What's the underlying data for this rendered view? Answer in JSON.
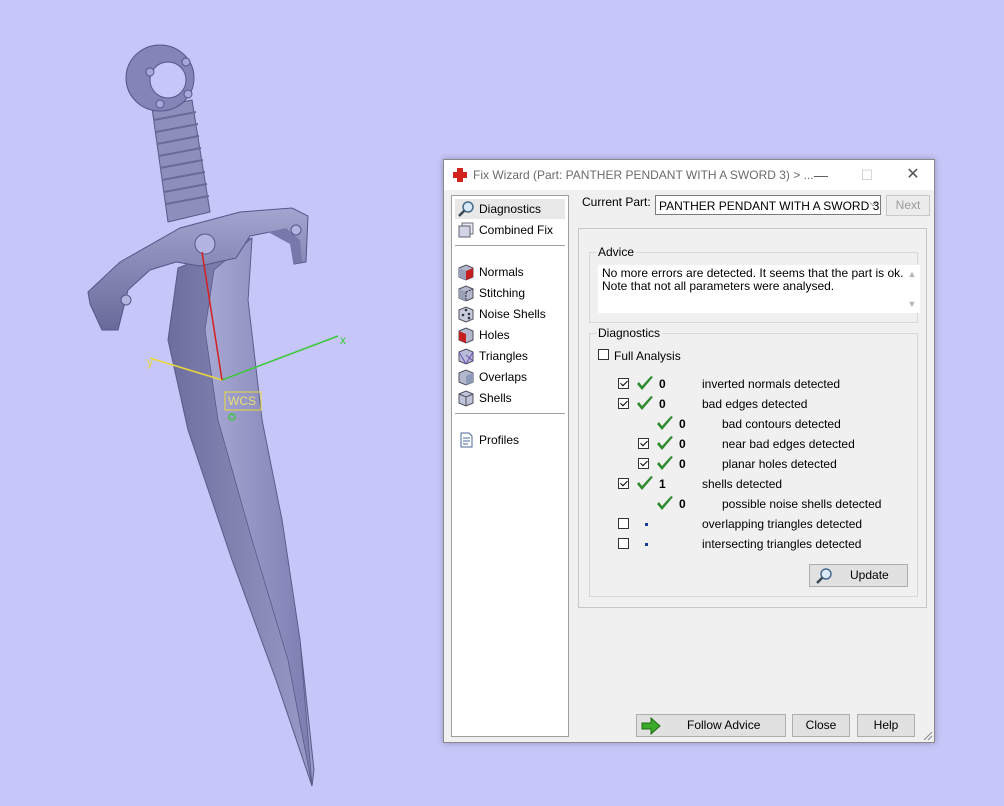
{
  "viewport": {
    "axis_x_label": "x",
    "axis_y_label": "y",
    "wcs_label": "WCS",
    "colors": {
      "background": "#c6c6f8",
      "axis_x": "#3cc83c",
      "axis_y": "#e8d83a",
      "axis_z": "#d42020",
      "model": "#8c8cc0"
    }
  },
  "dialog": {
    "title": "Fix Wizard (Part: PANTHER PENDANT WITH A SWORD 3) > ...",
    "nav": [
      {
        "label": "Diagnostics",
        "icon": "magnifier-icon"
      },
      {
        "label": "Combined Fix",
        "icon": "stacked-pages-icon"
      },
      {
        "label": "Normals",
        "icon": "cube-red-face-icon"
      },
      {
        "label": "Stitching",
        "icon": "cube-stitch-icon"
      },
      {
        "label": "Noise Shells",
        "icon": "dice-icon"
      },
      {
        "label": "Holes",
        "icon": "cube-red-hole-icon"
      },
      {
        "label": "Triangles",
        "icon": "cube-triangles-icon"
      },
      {
        "label": "Overlaps",
        "icon": "cube-overlap-icon"
      },
      {
        "label": "Shells",
        "icon": "cube-shell-icon"
      },
      {
        "label": "Profiles",
        "icon": "document-icon"
      }
    ],
    "current_part_label": "Current Part:",
    "current_part_value": "PANTHER PENDANT WITH A SWORD 3",
    "next_label": "Next",
    "advice_title": "Advice",
    "advice_text": "No more errors are detected. It seems that the part is ok.\nNote that not all parameters were analysed.",
    "diagnostics_title": "Diagnostics",
    "full_analysis_label": "Full Analysis",
    "rows": [
      {
        "checkbox": true,
        "checked": true,
        "status": "ok",
        "count": "0",
        "label": "inverted normals detected",
        "indent": 0
      },
      {
        "checkbox": true,
        "checked": true,
        "status": "ok",
        "count": "0",
        "label": "bad edges detected",
        "indent": 0
      },
      {
        "checkbox": false,
        "checked": false,
        "status": "ok",
        "count": "0",
        "label": "bad contours detected",
        "indent": 1
      },
      {
        "checkbox": true,
        "checked": true,
        "status": "ok",
        "count": "0",
        "label": "near bad edges detected",
        "indent": 1
      },
      {
        "checkbox": true,
        "checked": true,
        "status": "ok",
        "count": "0",
        "label": "planar holes detected",
        "indent": 1
      },
      {
        "checkbox": true,
        "checked": true,
        "status": "ok",
        "count": "1",
        "label": "shells detected",
        "indent": 0
      },
      {
        "checkbox": false,
        "checked": false,
        "status": "ok",
        "count": "0",
        "label": "possible noise shells detected",
        "indent": 1
      },
      {
        "checkbox": true,
        "checked": false,
        "status": "none",
        "count": "",
        "label": "overlapping triangles detected",
        "indent": 0
      },
      {
        "checkbox": true,
        "checked": false,
        "status": "none",
        "count": "",
        "label": "intersecting triangles detected",
        "indent": 0
      }
    ],
    "update_label": "Update",
    "follow_advice_label": "Follow Advice",
    "close_label": "Close",
    "help_label": "Help"
  }
}
